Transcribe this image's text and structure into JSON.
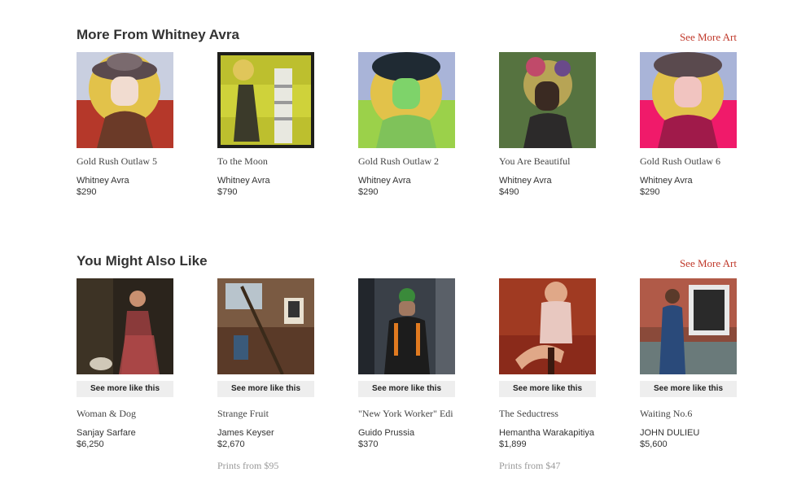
{
  "more_from": {
    "title": "More From Whitney Avra",
    "see_more": "See More Art",
    "items": [
      {
        "title": "Gold Rush Outlaw 5",
        "artist": "Whitney Avra",
        "price": "$290"
      },
      {
        "title": "To the Moon",
        "artist": "Whitney Avra",
        "price": "$790"
      },
      {
        "title": "Gold Rush Outlaw 2",
        "artist": "Whitney Avra",
        "price": "$290"
      },
      {
        "title": "You Are Beautiful",
        "artist": "Whitney Avra",
        "price": "$490"
      },
      {
        "title": "Gold Rush Outlaw 6",
        "artist": "Whitney Avra",
        "price": "$290"
      }
    ]
  },
  "also_like": {
    "title": "You Might Also Like",
    "see_more": "See More Art",
    "see_more_like": "See more like this",
    "items": [
      {
        "title": "Woman & Dog",
        "artist": "Sanjay Sarfare",
        "price": "$6,250",
        "prints": ""
      },
      {
        "title": "Strange Fruit",
        "artist": "James Keyser",
        "price": "$2,670",
        "prints": "Prints from $95"
      },
      {
        "title": "\"New York Worker\" Edi",
        "artist": "Guido Prussia",
        "price": "$370",
        "prints": ""
      },
      {
        "title": "The Seductress",
        "artist": "Hemantha Warakapitiya",
        "price": "$1,899",
        "prints": "Prints from $47"
      },
      {
        "title": "Waiting No.6",
        "artist": "JOHN DULIEU",
        "price": "$5,600",
        "prints": ""
      }
    ]
  },
  "colors": {
    "accent": "#c0392b",
    "button_bg": "#eeeeee"
  }
}
